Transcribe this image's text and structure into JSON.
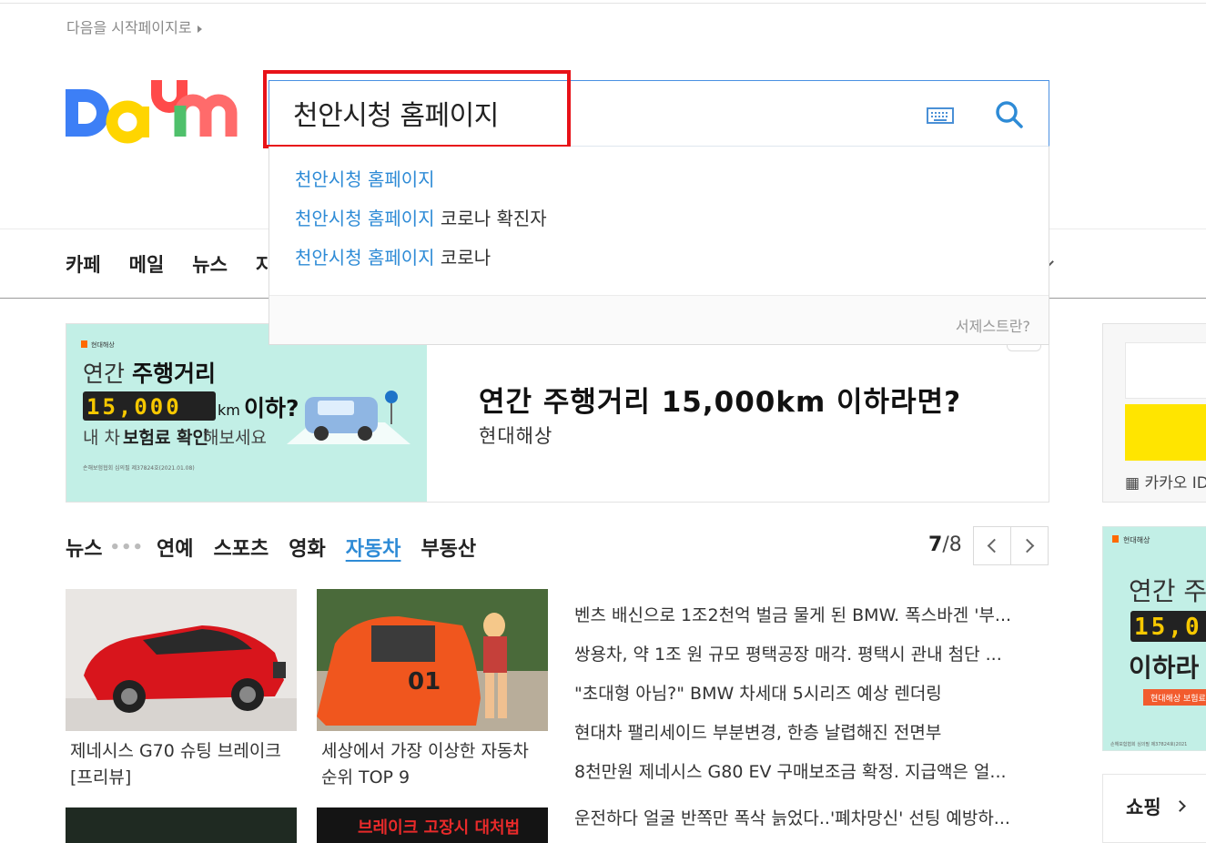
{
  "header": {
    "start_page_label": "다음을 시작페이지로",
    "logo_text": "Daum"
  },
  "search": {
    "query": "천안시청 홈페이지",
    "suggestions": [
      {
        "match": "천안시청 홈페이지",
        "rest": ""
      },
      {
        "match": "천안시청 홈페이지",
        "rest": " 코로나 확진자"
      },
      {
        "match": "천안시청 홈페이지",
        "rest": " 코로나"
      }
    ],
    "help_label": "서제스트란?"
  },
  "gnb": {
    "items": [
      "카페",
      "메일",
      "뉴스",
      "지"
    ]
  },
  "ad": {
    "brand_small": "현대해상",
    "img_line1_a": "연간",
    "img_line1_b": "주행거리",
    "img_digits": "15,000",
    "img_unit": "km",
    "img_suffix": "이하?",
    "img_line3_a": "내 차",
    "img_line3_b": "보험료 확인",
    "img_line3_c": "해보세요",
    "img_fine": "손해보험협회 심의필 제37824호(2021.01.08)",
    "title": "연간 주행거리 15,000km 이하라면?",
    "advertiser": "현대해상"
  },
  "news": {
    "tabs": [
      "뉴스",
      "연예",
      "스포츠",
      "영화",
      "자동차",
      "부동산"
    ],
    "active_tab": "자동차",
    "page_current": "7",
    "page_total": "/8",
    "cards": [
      {
        "caption": "제네시스 G70 슈팅 브레이크[프리뷰]"
      },
      {
        "caption": "세상에서 가장 이상한 자동차 순위 TOP 9"
      }
    ],
    "headlines": [
      "벤츠 배신으로 1조2천억 벌금 물게 된 BMW. 폭스바겐 '부...",
      "쌍용차, 약 1조 원 규모 평택공장 매각. 평택시 관내 첨단 ...",
      "\"초대형 아님?\" BMW 차세대 5시리즈 예상 렌더링",
      "현대차 팰리세이드 부분변경, 한층 날렵해진 전면부",
      "8천만원 제네시스 G80 EV 구매보조금 확정. 지급액은 얼..."
    ],
    "headline_next": "운전하다 얼굴 반쪽만 폭삭 늙었다..'폐차망신' 선팅 예방하...",
    "thumb2_text": "브레이크 고장시 대처법"
  },
  "right": {
    "kakao_label": "카카오 ID",
    "ad_brand": "현대해상",
    "ad_line1": "연간 주",
    "ad_digits": "15,0",
    "ad_line3": "이하라",
    "ad_badge": "현대해상 보험료",
    "ad_fine": "손해보험협회 심의필 제37824호(2021",
    "shopping_label": "쇼핑"
  }
}
